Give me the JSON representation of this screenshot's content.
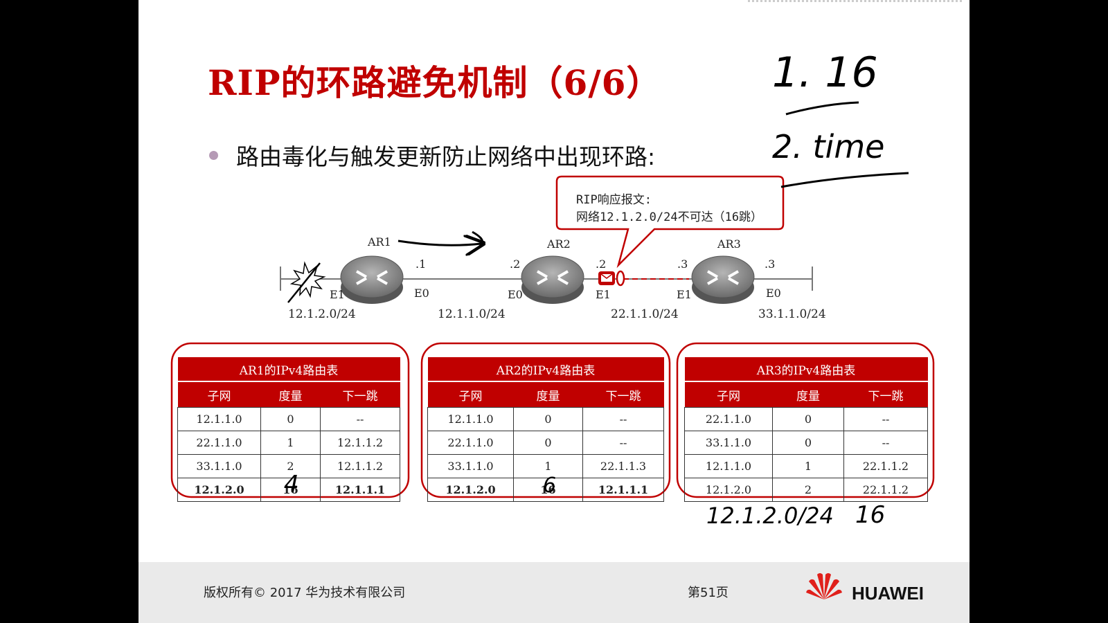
{
  "title": "RIP的环路避免机制（6/6）",
  "bullet": "路由毒化与触发更新防止网络中出现环路:",
  "callout": {
    "line1": "RIP响应报文:",
    "line2": "网络12.1.2.0/24不可达（16跳）"
  },
  "routers": [
    "AR1",
    "AR2",
    "AR3"
  ],
  "interfaces": {
    "ar1_left": "E1",
    "ar1_right": "E0",
    "ar2_left": "E0",
    "ar2_right": "E1",
    "ar3_left": "E1",
    "ar3_right": "E0"
  },
  "addresses": {
    "ar1_e0": ".1",
    "ar2_e0": ".2",
    "ar2_e1": ".2",
    "ar3_e1": ".3",
    "ar3_e0": ".3"
  },
  "networks": [
    "12.1.2.0/24",
    "12.1.1.0/24",
    "22.1.1.0/24",
    "33.1.1.0/24"
  ],
  "tables": [
    {
      "caption": "AR1的IPv4路由表",
      "headers": [
        "子网",
        "度量",
        "下一跳"
      ],
      "rows": [
        [
          "12.1.1.0",
          "0",
          "--"
        ],
        [
          "22.1.1.0",
          "1",
          "12.1.1.2"
        ],
        [
          "33.1.1.0",
          "2",
          "12.1.1.2"
        ],
        [
          "12.1.2.0",
          "16",
          "12.1.1.1"
        ]
      ]
    },
    {
      "caption": "AR2的IPv4路由表",
      "headers": [
        "子网",
        "度量",
        "下一跳"
      ],
      "rows": [
        [
          "12.1.1.0",
          "0",
          "--"
        ],
        [
          "22.1.1.0",
          "0",
          "--"
        ],
        [
          "33.1.1.0",
          "1",
          "22.1.1.3"
        ],
        [
          "12.1.2.0",
          "16",
          "12.1.1.1"
        ]
      ]
    },
    {
      "caption": "AR3的IPv4路由表",
      "headers": [
        "子网",
        "度量",
        "下一跳"
      ],
      "rows": [
        [
          "22.1.1.0",
          "0",
          "--"
        ],
        [
          "33.1.1.0",
          "0",
          "--"
        ],
        [
          "12.1.1.0",
          "1",
          "22.1.1.2"
        ],
        [
          "12.1.2.0",
          "2",
          "22.1.1.2"
        ]
      ]
    }
  ],
  "annotations": {
    "note1": "1. 16",
    "note2": "2. time",
    "metric_ar1": "4",
    "metric_ar2": "6",
    "bottom_net": "12.1.2.0/24",
    "bottom_metric": "16"
  },
  "footer": {
    "copyright": "版权所有© 2017 华为技术有限公司",
    "page": "第51页",
    "brand": "HUAWEI"
  },
  "colors": {
    "accent": "#c00000",
    "router": "#8a8a8a"
  }
}
